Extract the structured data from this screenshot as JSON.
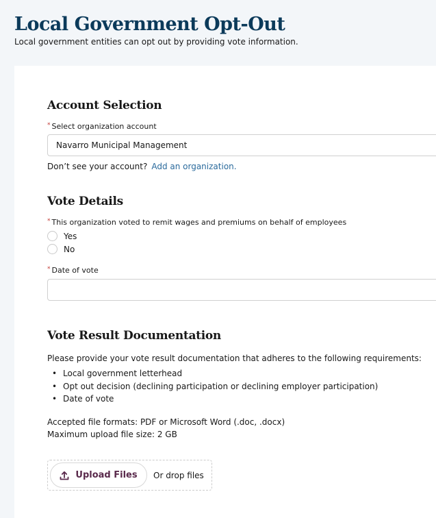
{
  "header": {
    "title": "Local Government Opt-Out",
    "subtitle": "Local government entities can opt out by providing vote information."
  },
  "account_selection": {
    "title": "Account Selection",
    "required_marker": "*",
    "field_label": "Select organization account",
    "field_value": "Navarro Municipal Management",
    "help_text": "Don’t see your account?",
    "help_link": "Add an organization."
  },
  "vote_details": {
    "title": "Vote Details",
    "required_marker": "*",
    "radio_label": "This organization voted to remit wages and premiums on behalf of employees",
    "options": [
      {
        "label": "Yes",
        "selected": false
      },
      {
        "label": "No",
        "selected": false
      }
    ],
    "date_label": "Date of vote",
    "date_value": ""
  },
  "documentation": {
    "title": "Vote Result Documentation",
    "intro": "Please provide your vote result documentation that adheres to the following requirements:",
    "requirements": [
      "Local government letterhead",
      "Opt out decision (declining participation or declining employer participation)",
      "Date of vote"
    ],
    "accepted_formats": "Accepted file formats: PDF or Microsoft Word (.doc, .docx)",
    "max_size": "Maximum upload file size: 2 GB",
    "upload_button": "Upload Files",
    "drop_text": "Or drop files"
  },
  "colors": {
    "title": "#0b3a5a",
    "link": "#2a6a9c",
    "required": "#c23934",
    "upload_button_text": "#5a2a4c",
    "page_background": "#f3f6f9"
  }
}
